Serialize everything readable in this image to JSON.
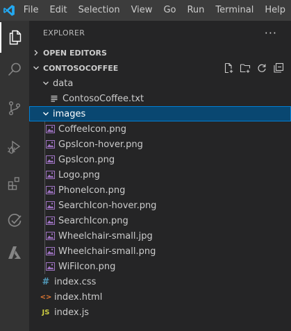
{
  "menu": {
    "items": [
      "File",
      "Edit",
      "Selection",
      "View",
      "Go",
      "Run",
      "Terminal",
      "Help"
    ]
  },
  "activity_bar": {
    "icons": [
      "explorer-icon",
      "search-icon",
      "source-control-icon",
      "run-debug-icon",
      "extensions-icon",
      "testing-icon",
      "azure-icon"
    ]
  },
  "explorer": {
    "title": "EXPLORER",
    "more": "···",
    "open_editors": "OPEN EDITORS",
    "workspace": "CONTOSOCOFFEE"
  },
  "tree": {
    "data_folder": "data",
    "data_files": [
      "ContosoCoffee.txt"
    ],
    "images_folder": "images",
    "image_files": [
      "CoffeeIcon.png",
      "GpsIcon-hover.png",
      "GpsIcon.png",
      "Logo.png",
      "PhoneIcon.png",
      "SearchIcon-hover.png",
      "SearchIcon.png",
      "Wheelchair-small.jpg",
      "Wheelchair-small.png",
      "WiFiIcon.png"
    ],
    "root_files": [
      {
        "name": "index.css",
        "icon": "#",
        "color": "#519aba"
      },
      {
        "name": "index.html",
        "icon": "<>",
        "color": "#e37933"
      },
      {
        "name": "index.js",
        "icon": "JS",
        "color": "#cbcb41"
      }
    ]
  },
  "colors": {
    "accent": "#007acc",
    "selection": "#094771",
    "image_icon": "#a074c4"
  }
}
